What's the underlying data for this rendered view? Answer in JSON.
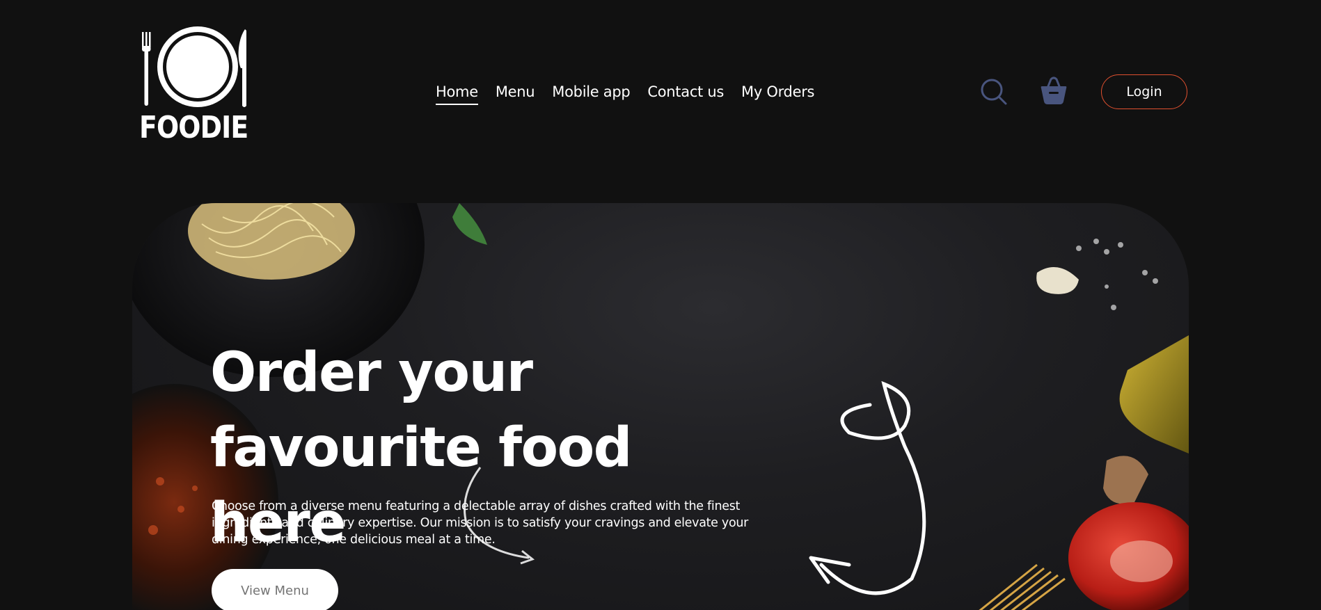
{
  "header": {
    "logo": {
      "text": "FOODIE",
      "icon": "plate-fork-knife-icon"
    },
    "nav": [
      {
        "label": "Home",
        "active": true
      },
      {
        "label": "Menu",
        "active": false
      },
      {
        "label": "Mobile app",
        "active": false
      },
      {
        "label": "Contact us",
        "active": false
      },
      {
        "label": "My Orders",
        "active": false
      }
    ],
    "icons": {
      "search": "search-icon",
      "basket": "basket-icon",
      "icon_color": "#49557e"
    },
    "login_label": "Login",
    "login_border_color": "#e0502f"
  },
  "hero": {
    "title_line1": "Order your",
    "title_line2": "favourite food here",
    "description": "Choose from a diverse menu featuring a delectable array of dishes crafted with the finest ingredients and culinary expertise. Our mission is to satisfy your cravings and elevate your dining experience, one delicious meal at a time.",
    "button_label": "View Menu"
  },
  "colors": {
    "page_background": "#111111",
    "text": "#ffffff",
    "button_text": "#747474"
  }
}
